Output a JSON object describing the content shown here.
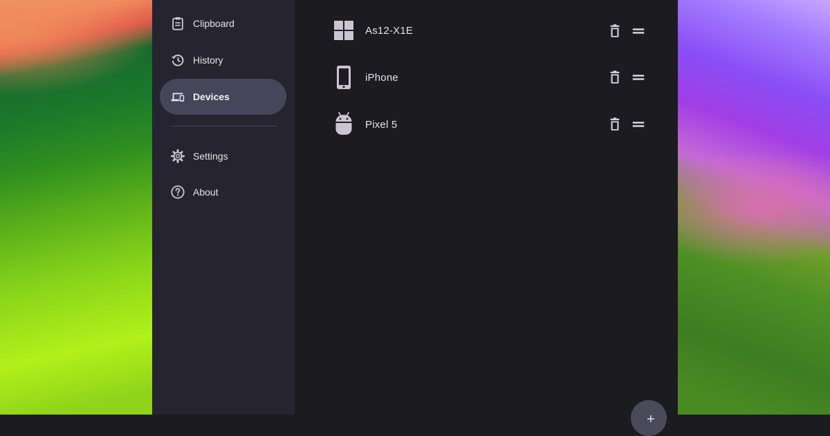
{
  "sidebar": {
    "items": [
      {
        "label": "Clipboard",
        "icon": "clipboard-icon"
      },
      {
        "label": "History",
        "icon": "history-icon"
      },
      {
        "label": "Devices",
        "icon": "devices-icon",
        "active": true
      },
      {
        "label": "Settings",
        "icon": "gear-icon"
      },
      {
        "label": "About",
        "icon": "help-circle-icon"
      }
    ]
  },
  "devices": [
    {
      "name": "As12-X1E",
      "icon": "windows-icon"
    },
    {
      "name": "iPhone",
      "icon": "phone-icon"
    },
    {
      "name": "Pixel 5",
      "icon": "android-icon"
    }
  ],
  "row_actions": {
    "delete_icon": "trash-icon",
    "reorder_icon": "drag-handle-icon"
  },
  "fab": {
    "label": "+"
  },
  "colors": {
    "sidebar_bg": "#252430",
    "main_bg": "#1c1b1f",
    "active_item_bg": "#454659",
    "text": "#e6e3ec",
    "icon": "#c9c6d2"
  }
}
